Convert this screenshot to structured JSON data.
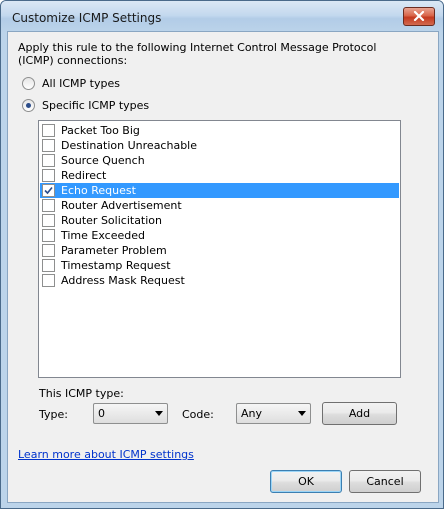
{
  "window": {
    "title": "Customize ICMP Settings"
  },
  "description": "Apply this rule to the following Internet Control Message Protocol (ICMP) connections:",
  "radios": [
    {
      "label": "All ICMP types",
      "checked": false
    },
    {
      "label": "Specific ICMP types",
      "checked": true
    }
  ],
  "icmp_types": [
    {
      "label": "Packet Too Big",
      "checked": false
    },
    {
      "label": "Destination Unreachable",
      "checked": false
    },
    {
      "label": "Source Quench",
      "checked": false
    },
    {
      "label": "Redirect",
      "checked": false
    },
    {
      "label": "Echo Request",
      "checked": true,
      "selected": true
    },
    {
      "label": "Router Advertisement",
      "checked": false
    },
    {
      "label": "Router Solicitation",
      "checked": false
    },
    {
      "label": "Time Exceeded",
      "checked": false
    },
    {
      "label": "Parameter Problem",
      "checked": false
    },
    {
      "label": "Timestamp Request",
      "checked": false
    },
    {
      "label": "Address Mask Request",
      "checked": false
    }
  ],
  "this_type": {
    "heading": "This ICMP type:",
    "type_label": "Type:",
    "type_value": "0",
    "code_label": "Code:",
    "code_value": "Any",
    "add_label": "Add"
  },
  "learn_more": "Learn more about ICMP settings",
  "buttons": {
    "ok": "OK",
    "cancel": "Cancel"
  }
}
